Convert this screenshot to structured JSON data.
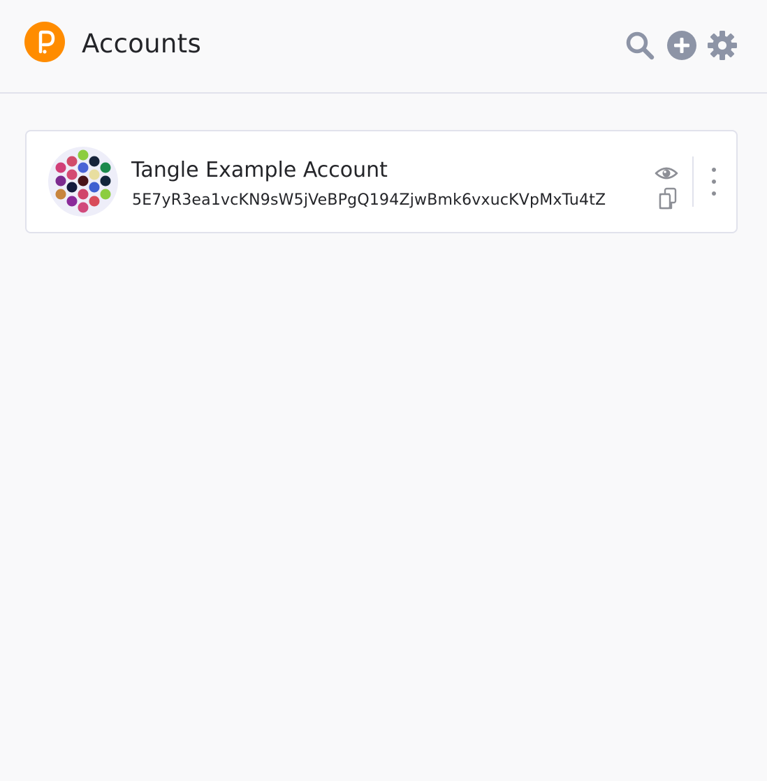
{
  "header": {
    "title": "Accounts",
    "logo_icon": "polkadot-logo-icon",
    "actions": {
      "search_icon": "search-icon",
      "add_icon": "add-circle-icon",
      "settings_icon": "gear-icon"
    }
  },
  "accounts": [
    {
      "name": "Tangle Example Account",
      "address": "5E7yR3ea1vcKN9sW5jVeBPgQ194ZjwBmk6vxucKVpMxTu4tZ",
      "avatar_icon": "identicon",
      "actions": {
        "visibility_icon": "eye-icon",
        "copy_icon": "copy-icon",
        "menu_icon": "more-vertical-icon"
      }
    }
  ],
  "colors": {
    "background": "#f9f9fa",
    "card": "#ffffff",
    "border": "#e1e2ec",
    "accent": "#ff8c00",
    "icon_gray": "#8d94a6",
    "text": "#242529"
  }
}
